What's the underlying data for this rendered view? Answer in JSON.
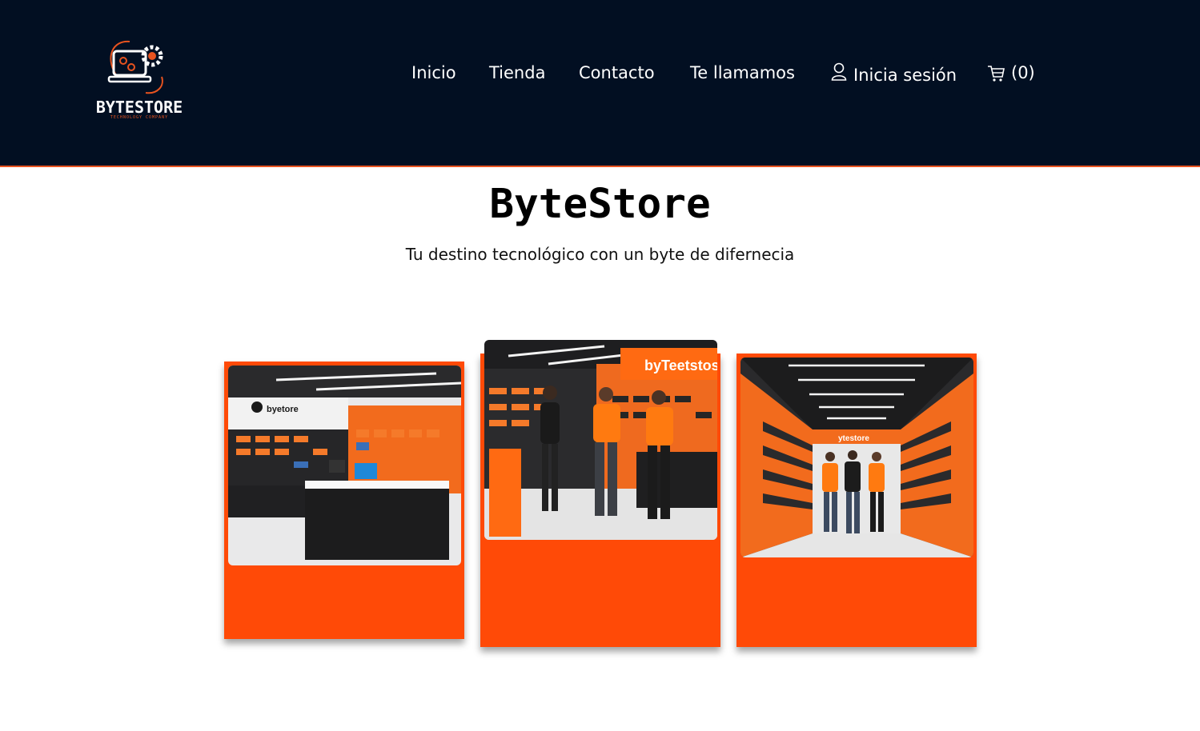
{
  "header": {
    "logo_text": "BYTESTORE",
    "logo_subtext": "TECHNOLOGY COMPANY",
    "nav": {
      "inicio": "Inicio",
      "tienda": "Tienda",
      "contacto": "Contacto",
      "te_llamamos": "Te llamamos",
      "login": "Inicia sesión",
      "cart_count": "(0)"
    },
    "icons": {
      "login": "user-icon",
      "cart": "cart-icon"
    }
  },
  "hero": {
    "title": "ByteStore",
    "subtitle": "Tu destino tecnológico con un byte de difernecia"
  },
  "gallery": {
    "photos": [
      {
        "alt": "store-interior-photo",
        "sign_text": "byetore"
      },
      {
        "alt": "store-staff-photo",
        "sign_text": "byTeetstos"
      },
      {
        "alt": "store-aisle-photo",
        "sign_text": "ytestore"
      }
    ]
  },
  "colors": {
    "header_bg": "#020f22",
    "accent": "#ff4a07",
    "border": "#e8531f"
  }
}
